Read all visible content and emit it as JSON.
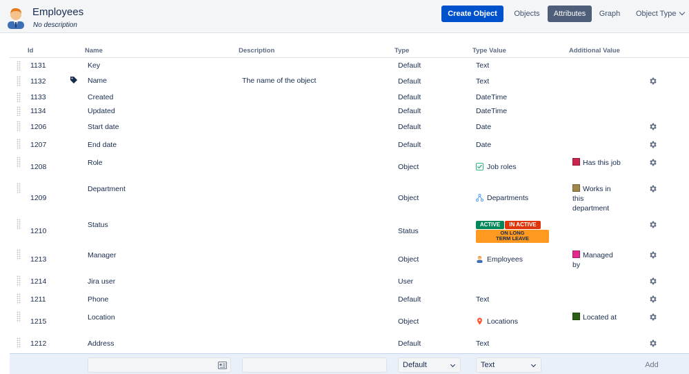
{
  "header": {
    "title": "Employees",
    "description": "No description",
    "create_button": "Create Object",
    "nav": {
      "objects": "Objects",
      "attributes": "Attributes",
      "graph": "Graph",
      "object_type": "Object Type"
    }
  },
  "table": {
    "columns": {
      "id": "Id",
      "name": "Name",
      "description": "Description",
      "type": "Type",
      "type_value": "Type Value",
      "additional_value": "Additional Value"
    },
    "rows": [
      {
        "id": "1131",
        "name": "Key",
        "description": "",
        "type": "Default",
        "type_value": "Text",
        "additional_value": ""
      },
      {
        "id": "1132",
        "name": "Name",
        "description": "The name of the object",
        "type": "Default",
        "type_value": "Text",
        "additional_value": ""
      },
      {
        "id": "1133",
        "name": "Created",
        "description": "",
        "type": "Default",
        "type_value": "DateTime",
        "additional_value": ""
      },
      {
        "id": "1134",
        "name": "Updated",
        "description": "",
        "type": "Default",
        "type_value": "DateTime",
        "additional_value": ""
      },
      {
        "id": "1206",
        "name": "Start date",
        "description": "",
        "type": "Default",
        "type_value": "Date",
        "additional_value": ""
      },
      {
        "id": "1207",
        "name": "End date",
        "description": "",
        "type": "Default",
        "type_value": "Date",
        "additional_value": ""
      },
      {
        "id": "1208",
        "name": "Role",
        "description": "",
        "type": "Object",
        "type_value": "Job roles",
        "additional_value": "Has this job"
      },
      {
        "id": "1209",
        "name": "Department",
        "description": "",
        "type": "Object",
        "type_value": "Departments",
        "additional_value": "Works in this department"
      },
      {
        "id": "1210",
        "name": "Status",
        "description": "",
        "type": "Status",
        "type_value": "",
        "additional_value": ""
      },
      {
        "id": "1213",
        "name": "Manager",
        "description": "",
        "type": "Object",
        "type_value": "Employees",
        "additional_value": "Managed by"
      },
      {
        "id": "1214",
        "name": "Jira user",
        "description": "",
        "type": "User",
        "type_value": "",
        "additional_value": ""
      },
      {
        "id": "1211",
        "name": "Phone",
        "description": "",
        "type": "Default",
        "type_value": "Text",
        "additional_value": ""
      },
      {
        "id": "1215",
        "name": "Location",
        "description": "",
        "type": "Object",
        "type_value": "Locations",
        "additional_value": "Located at"
      },
      {
        "id": "1212",
        "name": "Address",
        "description": "",
        "type": "Default",
        "type_value": "Text",
        "additional_value": ""
      }
    ],
    "status_badges": {
      "active": "ACTIVE",
      "inactive": "IN ACTIVE",
      "on_leave": "ON LONG TERM LEAVE"
    },
    "swatch_colors": {
      "has_this_job": "#c8254f",
      "works_in_this_department": "#a08548",
      "managed_by": "#e12b8c",
      "located_at": "#2b5f18"
    }
  },
  "footer": {
    "type_select": "Default",
    "type_value_select": "Text",
    "add_button": "Add"
  }
}
